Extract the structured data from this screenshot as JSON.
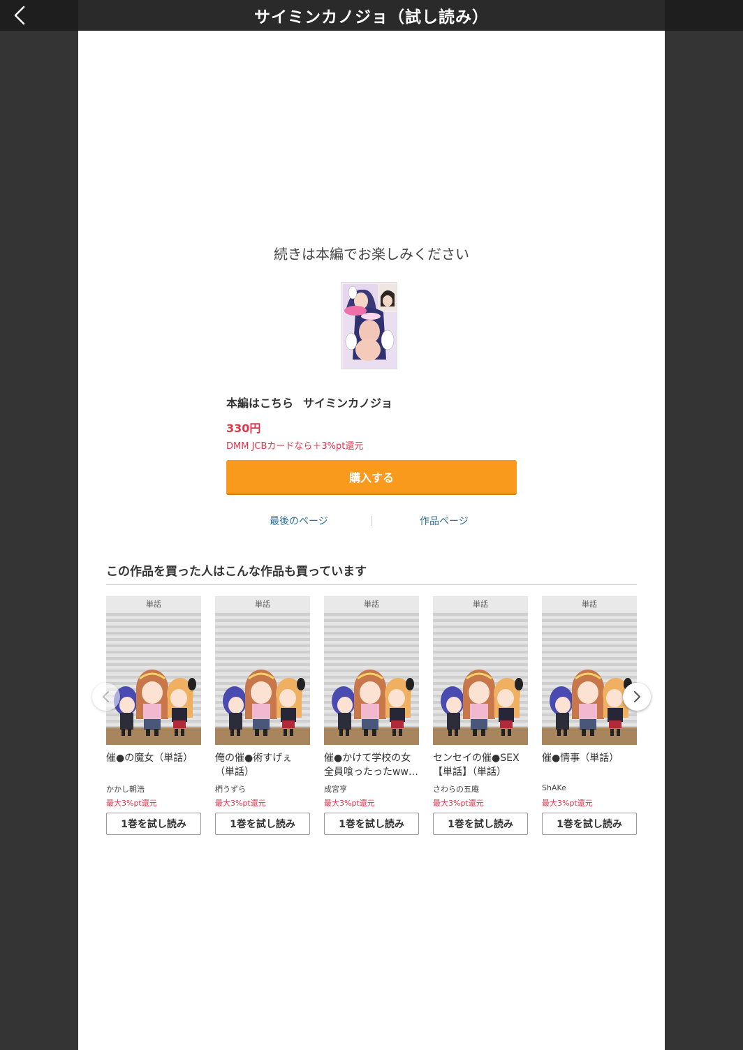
{
  "header": {
    "title": "サイミンカノジョ（試し読み）",
    "back_icon": "chevron-left-icon"
  },
  "end_screen": {
    "continue_message": "続きは本編でお楽しみください",
    "main_link_label": "本編はこちら",
    "main_title": "サイミンカノジョ",
    "price": "330円",
    "point_note": "DMM JCBカードなら＋3%pt還元",
    "buy_label": "購入する",
    "last_page_label": "最後のページ",
    "work_page_label": "作品ページ"
  },
  "recommendations": {
    "heading": "この作品を買った人はこんな作品も買っています",
    "items": [
      {
        "tag": "単話",
        "title": "催●の魔女（単話）",
        "author": "かかし朝浩",
        "point": "最大3%pt還元",
        "button": "1巻を試し読み"
      },
      {
        "tag": "単話",
        "title": "俺の催●術すげぇ（単話）",
        "author": "椚うずら",
        "point": "最大3%pt還元",
        "button": "1巻を試し読み"
      },
      {
        "tag": "単話",
        "title": "催●かけて学校の女全員喰ったったww…",
        "author": "成宮亨",
        "point": "最大3%pt還元",
        "button": "1巻を試し読み"
      },
      {
        "tag": "単話",
        "title": "センセイの催●SEX【単話】（単話）",
        "author": "さわらの五庵",
        "point": "最大3%pt還元",
        "button": "1巻を試し読み"
      },
      {
        "tag": "単話",
        "title": "催●情事（単話）",
        "author": "ShAKe",
        "point": "最大3%pt還元",
        "button": "1巻を試し読み"
      }
    ]
  },
  "colors": {
    "accent_orange": "#f99a1c",
    "price_red": "#e0344b",
    "link_blue": "#2f6f96",
    "header_bg": "#2a2a2a",
    "page_bg": "#343434"
  }
}
